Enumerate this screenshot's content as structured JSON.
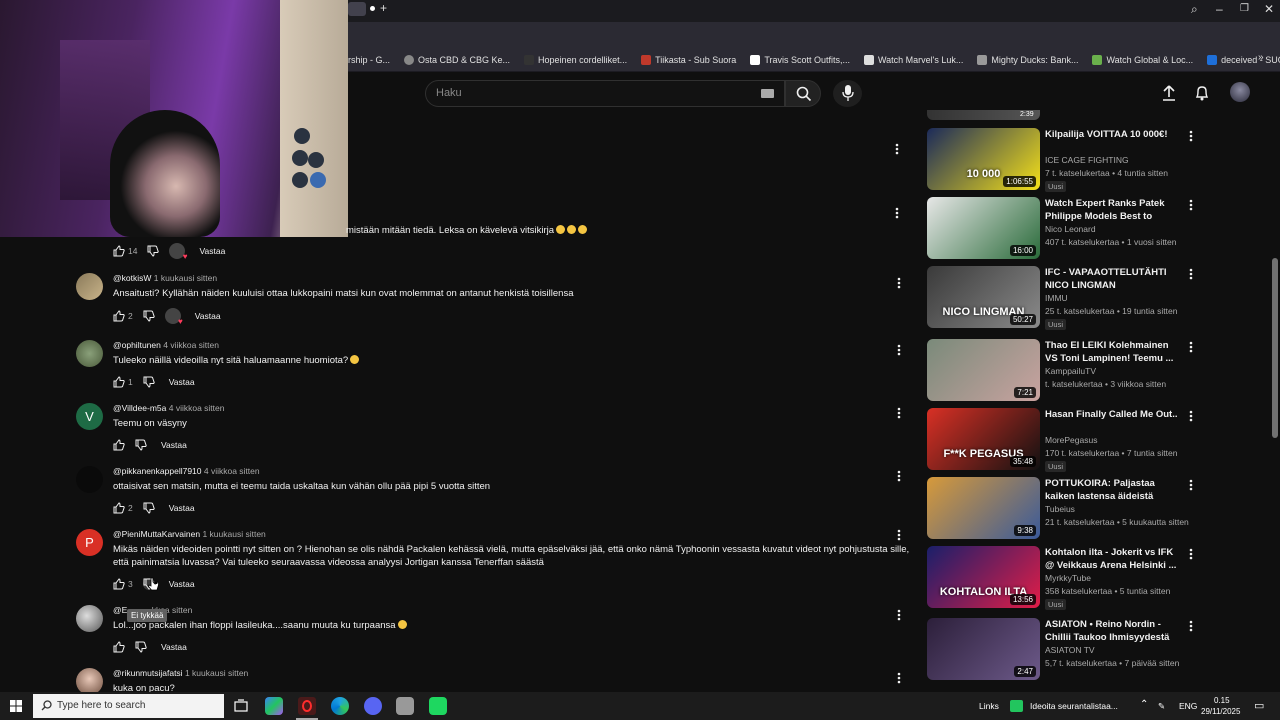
{
  "browser": {
    "bookmarks": [
      "rship - G...",
      "Osta CBD & CBG Ke...",
      "Hopeinen cordelliket...",
      "Tiikasta - Sub Suora",
      "Travis Scott Outfits,...",
      "Watch Marvel's Luk...",
      "Mighty Ducks: Bank...",
      "Watch Global & Loc...",
      "deceived - SUORAT..."
    ],
    "bookmark_colors": [
      "#888",
      "#888",
      "#333",
      "#c0392b",
      "#fff",
      "#ddd",
      "#999",
      "#6ab04c",
      "#1e6fd9"
    ]
  },
  "youtube": {
    "search_placeholder": "Haku"
  },
  "comments": [
    {
      "user": "",
      "time": "",
      "text": "mistään mitään tiedä. Leksa on kävelevä vitsikirja",
      "likes": "14",
      "reply": "Vastaa"
    },
    {
      "user": "@kotkisW",
      "time": "1 kuukausi sitten",
      "text": "Ansaitusti? Kyllähän näiden kuuluisi ottaa lukkopaini matsi kun ovat molemmat on antanut henkistä toisillensa",
      "likes": "2",
      "reply": "Vastaa"
    },
    {
      "user": "@ophiltunen",
      "time": "4 viikkoa sitten",
      "text": "Tuleeko näillä videoilla nyt sitä haluamaanne huomiota?",
      "likes": "1",
      "reply": "Vastaa"
    },
    {
      "user": "@Villdee-m5a",
      "time": "4 viikkoa sitten",
      "text": "Teemu on väsyny",
      "likes": "",
      "reply": "Vastaa"
    },
    {
      "user": "@pikkanenkappell7910",
      "time": "4 viikkoa sitten",
      "text": "ottaisivat sen matsin, mutta ei teemu taida uskaltaa kun vähän ollu pää pipi 5 vuotta sitten",
      "likes": "2",
      "reply": "Vastaa"
    },
    {
      "user": "@PieniMuttaKarvainen",
      "time": "1 kuukausi sitten",
      "text": "Mikäs näiden videoiden pointti nyt sitten on ? Hienohan se olis nähdä Packalen kehässä vielä, mutta epäselväksi jää, että onko nämä Typhoonin vessasta kuvatut videot nyt pohjustusta sille, että painimatsia luvassa? Vai tuleeko seuraavassa videossa analyysi Jortigan kanssa Tenerffan säästä",
      "likes": "3",
      "reply": "Vastaa"
    },
    {
      "user": "@E",
      "time": "kkoa sitten",
      "text": "Lol...joo packalen ihan floppi lasileuka....saanu muuta ku turpaansa",
      "likes": "",
      "reply": "Vastaa"
    },
    {
      "user": "@rikunmutsijafatsi",
      "time": "1 kuukausi sitten",
      "text": "kuka on pacu?",
      "likes": "",
      "reply": ""
    }
  ],
  "tooltip": "Ei tykkää",
  "sidebar": [
    {
      "title": "Kilpailija VOITTAA 10 000€!",
      "channel": "ICE CAGE FIGHTING",
      "meta": "7 t. katselukertaa • 4 tuntia sitten",
      "badge": "Uusi",
      "duration": "1:06:55",
      "thumb_colors": [
        "#1b2a5a",
        "#f5e11a"
      ],
      "thumb_text": "10 000"
    },
    {
      "title": "Watch Expert Ranks Patek Philippe Models Best to Worst",
      "channel": "Nico Leonard",
      "meta": "407 t. katselukertaa • 1 vuosi sitten",
      "badge": "",
      "duration": "16:00",
      "thumb_colors": [
        "#e7e7e7",
        "#2a6b3a"
      ],
      "thumb_text": ""
    },
    {
      "title": "IFC - VAPAAOTTELUTÄHTI NICO LINGMAN",
      "channel": "IMMU",
      "meta": "25 t. katselukertaa • 19 tuntia sitten",
      "badge": "Uusi",
      "duration": "50:27",
      "thumb_colors": [
        "#3a3a3a",
        "#8a8a8a"
      ],
      "thumb_text": "NICO LINGMAN"
    },
    {
      "title": "Thao EI LEIKI Kolehmainen VS Toni Lampinen! Teemu ...",
      "channel": "KamppailuTV",
      "meta": "t. katselukertaa • 3 viikkoa sitten",
      "badge": "",
      "duration": "7:21",
      "thumb_colors": [
        "#7a8a7a",
        "#c9a3a0"
      ],
      "thumb_text": ""
    },
    {
      "title": "Hasan Finally Called Me Out..",
      "channel": "MorePegasus",
      "meta": "170 t. katselukertaa • 7 tuntia sitten",
      "badge": "Uusi",
      "duration": "35:48",
      "thumb_colors": [
        "#d93025",
        "#111"
      ],
      "thumb_text": "F**K PEGASUS"
    },
    {
      "title": "POTTUKOIRA: Paljastaa kaiken lastensa äideistä #pottukoira ...",
      "channel": "Tubeius",
      "meta": "21 t. katselukertaa • 5 kuukautta sitten",
      "badge": "",
      "duration": "9:38",
      "thumb_colors": [
        "#d79a3a",
        "#3a5a9a"
      ],
      "thumb_text": ""
    },
    {
      "title": "Kohtalon ilta - Jokerit vs IFK @ Veikkaus Arena Helsinki ...",
      "channel": "MyrkkyTube",
      "meta": "358 katselukertaa • 5 tuntia sitten",
      "badge": "Uusi",
      "duration": "13:56",
      "thumb_colors": [
        "#1a1f6a",
        "#e11d48"
      ],
      "thumb_text": "KOHTALON ILTA"
    },
    {
      "title": "ASIATON • Reino Nordin - Chillii Taukoo Ihmisyydestä",
      "channel": "ASIATON TV",
      "meta": "5,7 t. katselukertaa • 7 päivää sitten",
      "badge": "",
      "duration": "2:47",
      "thumb_colors": [
        "#2c1f3a",
        "#6d5a8a"
      ],
      "thumb_text": ""
    }
  ],
  "taskbar": {
    "search_placeholder": "Type here to search",
    "links": "Links",
    "notification": "Ideoita seurantalistaa...",
    "lang": "ENG",
    "time": "0.15",
    "date": "29/11/2025"
  }
}
